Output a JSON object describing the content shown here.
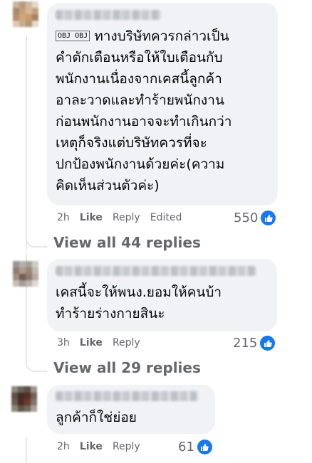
{
  "comments": [
    {
      "text": "ทางบริษัทควรกล่าวเป็น\nคำตักเตือนหรือให้ใบเตือนกับ\nพนักงานเนื่องจากเคสนี้ลูกค้า\nอาละวาดและทำร้ายพนักงาน\nก่อนพนักงานอาจจะทำเกินกว่า\nเหตุก็จริงแต่บริษัทควรที่จะ\nปกป้องพนักงานด้วยค่ะ(ความ\nคิดเห็นส่วนตัวค่ะ)",
      "prefix_icon": "OBJ OBJ",
      "time": "2h",
      "like": "Like",
      "reply": "Reply",
      "edited": "Edited",
      "reaction_count": "550",
      "view_replies": "View all 44 replies"
    },
    {
      "text": "เคสนี้จะให้พนง.ยอมให้คนบ้า\nทำร้ายร่างกายสินะ",
      "time": "3h",
      "like": "Like",
      "reply": "Reply",
      "reaction_count": "215",
      "view_replies": "View all 29 replies"
    },
    {
      "text": "ลูกค้าก็ใช่ย่อย",
      "time": "2h",
      "like": "Like",
      "reply": "Reply",
      "reaction_count": "61"
    }
  ],
  "colors": {
    "bubble": "#f0f2f5",
    "meta": "#65676b",
    "like_blue": "#1877f2",
    "thread_line": "#e4e6eb"
  },
  "icons": [
    "like-thumb-icon",
    "obj-placeholder-icon",
    "avatar"
  ]
}
